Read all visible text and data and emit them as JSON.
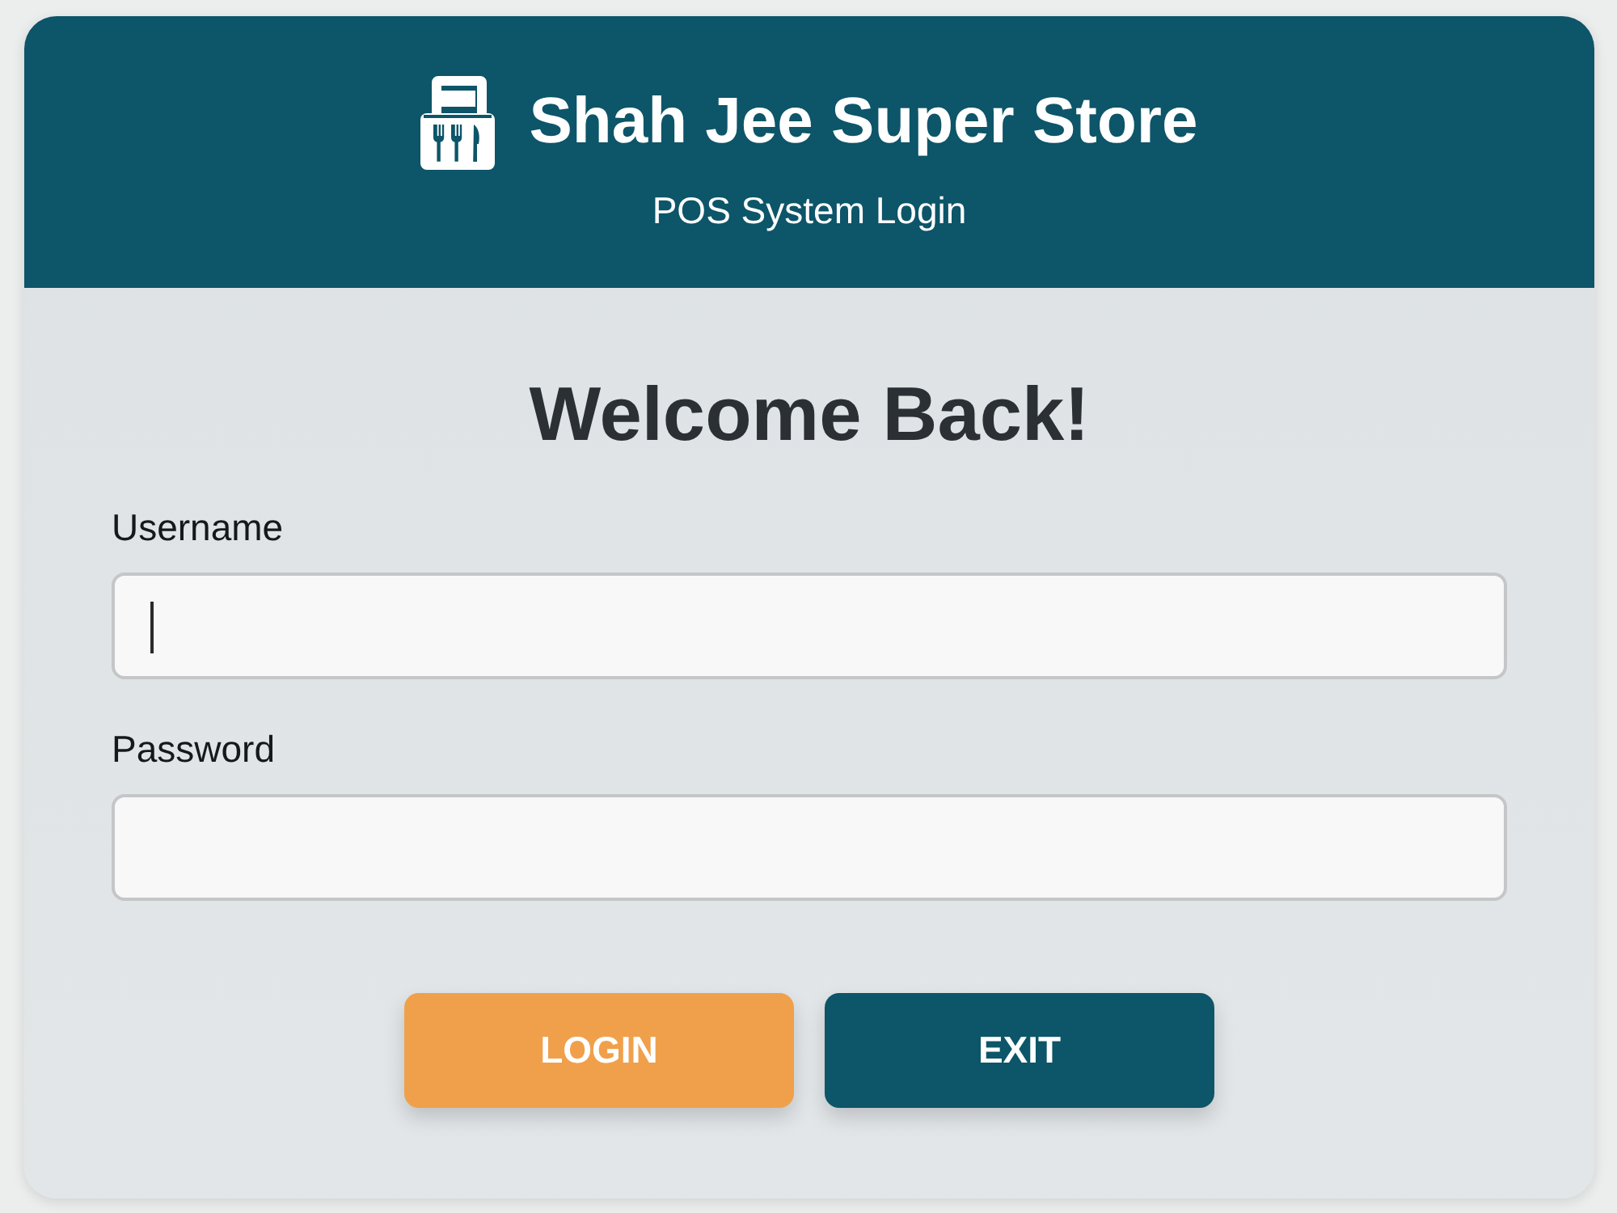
{
  "header": {
    "title": "Shah Jee Super Store",
    "subtitle": "POS System Login"
  },
  "form": {
    "heading": "Welcome Back!",
    "fields": [
      {
        "label": "Username",
        "focused": true
      },
      {
        "label": "Password",
        "focused": false
      }
    ]
  },
  "buttons": [
    {
      "label": "LOGIN",
      "kind": "primary"
    },
    {
      "label": "EXIT",
      "kind": "secondary"
    }
  ]
}
